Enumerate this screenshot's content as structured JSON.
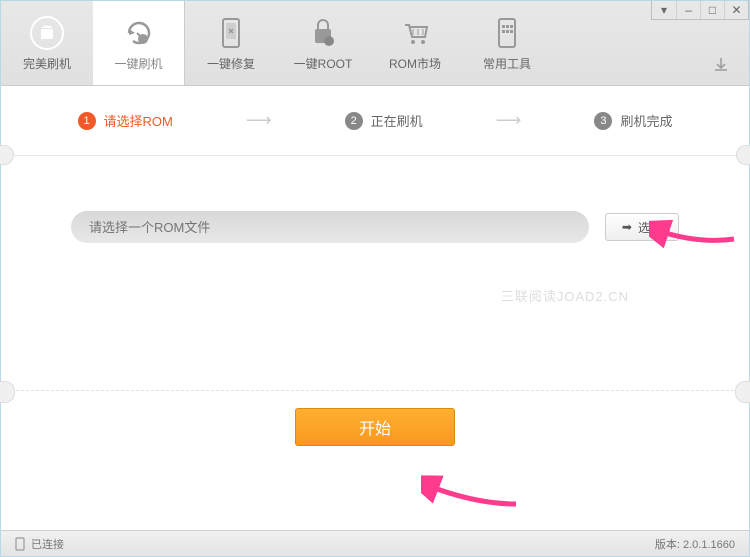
{
  "window_controls": {
    "dropdown": "▾",
    "min": "–",
    "max": "□",
    "close": "✕"
  },
  "nav": [
    {
      "label": "完美刷机"
    },
    {
      "label": "一键刷机"
    },
    {
      "label": "一键修复"
    },
    {
      "label": "一键ROOT"
    },
    {
      "label": "ROM市场"
    },
    {
      "label": "常用工具"
    }
  ],
  "steps": [
    {
      "num": "1",
      "label": "请选择ROM"
    },
    {
      "num": "2",
      "label": "正在刷机"
    },
    {
      "num": "3",
      "label": "刷机完成"
    }
  ],
  "rom": {
    "placeholder": "请选择一个ROM文件",
    "select_label": "选择"
  },
  "watermark": "三联阅读JOAD2.CN",
  "start_label": "开始",
  "status": {
    "connected": "已连接",
    "version": "版本: 2.0.1.1660"
  }
}
